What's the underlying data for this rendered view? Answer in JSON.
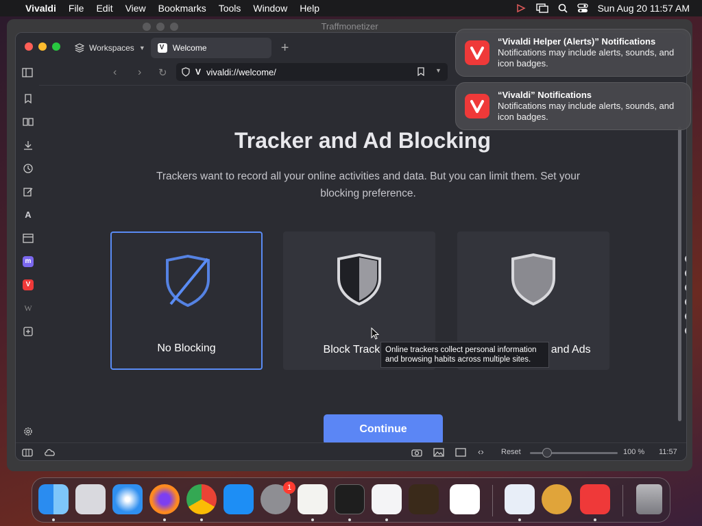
{
  "menubar": {
    "app_name": "Vivaldi",
    "items": [
      "File",
      "Edit",
      "View",
      "Bookmarks",
      "Tools",
      "Window",
      "Help"
    ],
    "datetime": "Sun Aug 20  11:57 AM"
  },
  "background_window": {
    "title": "Traffmonetizer"
  },
  "browser": {
    "workspaces_label": "Workspaces",
    "tab_title": "Welcome",
    "url": "vivaldi://welcome/"
  },
  "page": {
    "heading": "Tracker and Ad Blocking",
    "subtext": "Trackers want to record all your online activities and data. But you can limit them. Set your blocking preference.",
    "options": [
      {
        "label": "No Blocking",
        "selected": true
      },
      {
        "label": "Block Trackers",
        "selected": false
      },
      {
        "label": "Block Trackers and Ads",
        "selected": false
      }
    ],
    "tooltip": "Online trackers collect personal information and browsing habits across multiple sites.",
    "continue_label": "Continue",
    "step_count": 6,
    "current_step": 2
  },
  "statusbar": {
    "reset_label": "Reset",
    "zoom": "100 %",
    "clock": "11:57"
  },
  "notifications": [
    {
      "title": "“Vivaldi Helper (Alerts)” Notifications",
      "body": "Notifications may include alerts, sounds, and icon badges."
    },
    {
      "title": "“Vivaldi” Notifications",
      "body": "Notifications may include alerts, sounds, and icon badges."
    }
  ],
  "dock": {
    "settings_badge": "1",
    "icons": [
      "finder-icon",
      "launchpad-icon",
      "safari-icon",
      "firefox-icon",
      "chrome-icon",
      "app-store-icon",
      "system-settings-icon",
      "textedit-icon",
      "terminal-icon",
      "vectorize-icon",
      "garageband-icon",
      "vscode-icon",
      "remote-desktop-icon",
      "cocktail-icon",
      "vivaldi-icon",
      "trash-icon"
    ]
  },
  "colors": {
    "accent": "#5b86f5",
    "vivaldi_red": "#ef3939"
  }
}
